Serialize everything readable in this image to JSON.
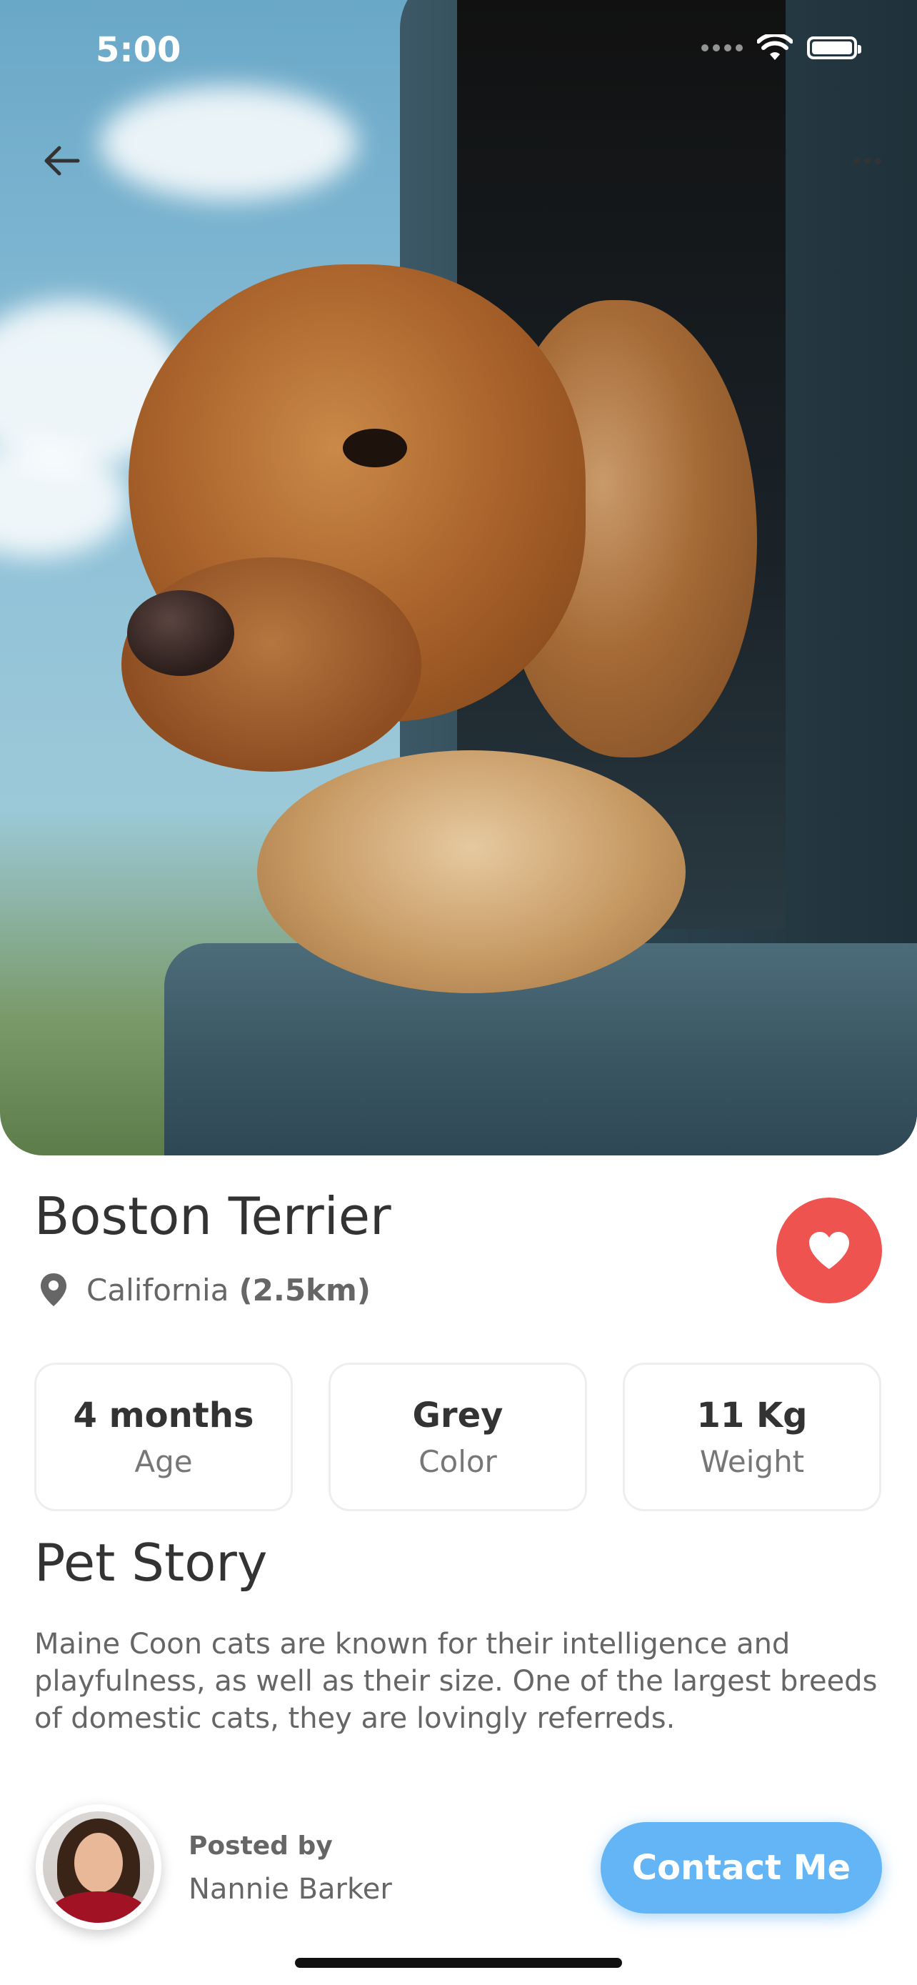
{
  "status_bar": {
    "time": "5:00"
  },
  "pet": {
    "name": "Boston Terrier",
    "location": "California",
    "distance": "(2.5km)",
    "favorited": true
  },
  "stats": [
    {
      "value": "4 months",
      "label": "Age"
    },
    {
      "value": "Grey",
      "label": "Color"
    },
    {
      "value": "11 Kg",
      "label": "Weight"
    }
  ],
  "story": {
    "heading": "Pet Story",
    "text": "Maine Coon cats are known for their intelligence and playfulness, as well as their size. One of the largest breeds of domestic cats, they are lovingly referreds."
  },
  "owner": {
    "posted_by_label": "Posted by",
    "name": "Nannie Barker"
  },
  "actions": {
    "contact_label": "Contact Me"
  },
  "colors": {
    "favorite": "#ef5350",
    "contact": "#64b5f6"
  },
  "icons": [
    "back-arrow-icon",
    "more-icon",
    "location-pin-icon",
    "heart-icon",
    "wifi-icon",
    "battery-icon"
  ]
}
